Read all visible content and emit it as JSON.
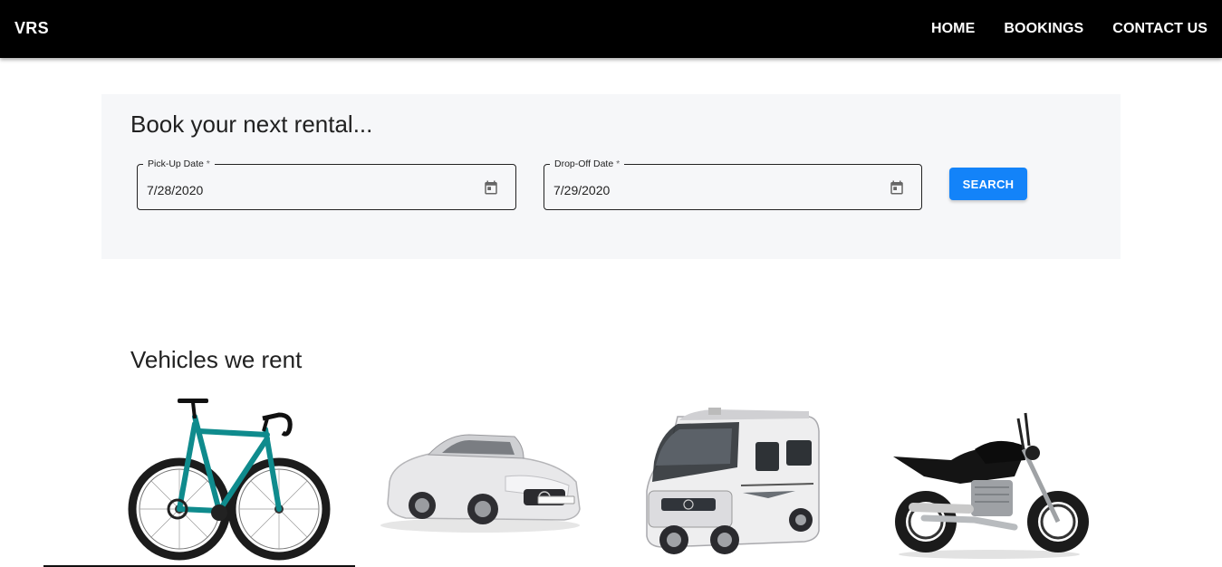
{
  "app": {
    "brand": "VRS"
  },
  "nav": {
    "items": [
      "HOME",
      "BOOKINGS",
      "CONTACT US"
    ]
  },
  "booking": {
    "title": "Book your next rental...",
    "pickup": {
      "label": "Pick-Up Date",
      "required_mark": "*",
      "value": "7/28/2020",
      "icon": "calendar-icon"
    },
    "dropoff": {
      "label": "Drop-Off Date",
      "required_mark": "*",
      "value": "7/29/2020",
      "icon": "calendar-icon"
    },
    "search_label": "SEARCH"
  },
  "vehicles": {
    "title": "Vehicles we rent",
    "items": [
      "bicycle-image",
      "convertible-car-image",
      "camper-van-image",
      "motorcycle-image"
    ]
  },
  "colors": {
    "appbar": "#000000",
    "accent": "#1383f9",
    "panel": "#f6f7f9",
    "bike_frame": "#0f8b8d"
  }
}
